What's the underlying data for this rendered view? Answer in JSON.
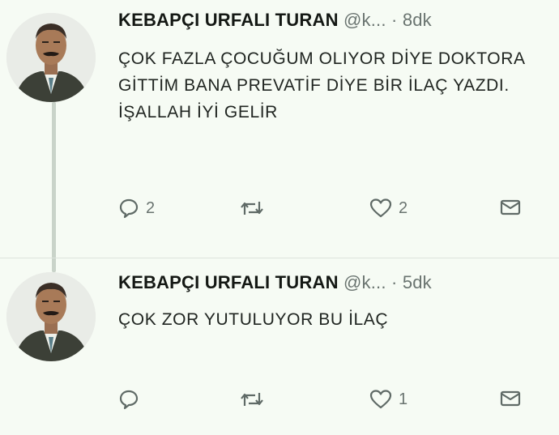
{
  "tweets": [
    {
      "author_name": "KEBAPÇI URFALI TURAN",
      "handle": "@k...",
      "separator": "·",
      "time": "8dk",
      "text": "ÇOK FAZLA ÇOCUĞUM OLIYOR DİYE DOKTORA GİTTİM BANA PREVATİF DİYE BİR İLAÇ YAZDI. İŞALLAH İYİ GELİR",
      "reply_count": "2",
      "retweet_count": "",
      "like_count": "2",
      "icons": [
        "reply-icon",
        "retweet-icon",
        "like-icon",
        "direct-message-icon"
      ]
    },
    {
      "author_name": "KEBAPÇI URFALI TURAN",
      "handle": "@k...",
      "separator": "·",
      "time": "5dk",
      "text": "ÇOK ZOR YUTULUYOR BU İLAÇ",
      "reply_count": "",
      "retweet_count": "",
      "like_count": "1",
      "icons": [
        "reply-icon",
        "retweet-icon",
        "like-icon",
        "direct-message-icon"
      ]
    }
  ],
  "colors": {
    "background": "#f6fbf4",
    "text": "#1c211d",
    "muted": "#6a7470",
    "thread_line": "#c9d3c9"
  }
}
